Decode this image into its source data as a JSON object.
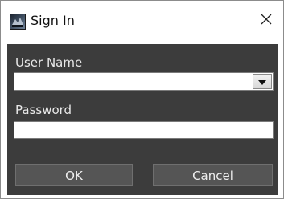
{
  "window": {
    "title": "Sign In",
    "icon": "app-icon",
    "close_icon": "close-icon"
  },
  "form": {
    "username_label": "User Name",
    "username_value": "",
    "password_label": "Password",
    "password_value": ""
  },
  "buttons": {
    "ok_label": "OK",
    "cancel_label": "Cancel"
  },
  "colors": {
    "panel_bg": "#3c3c3c",
    "button_bg": "#555555",
    "label_text": "#e8e8e8"
  }
}
